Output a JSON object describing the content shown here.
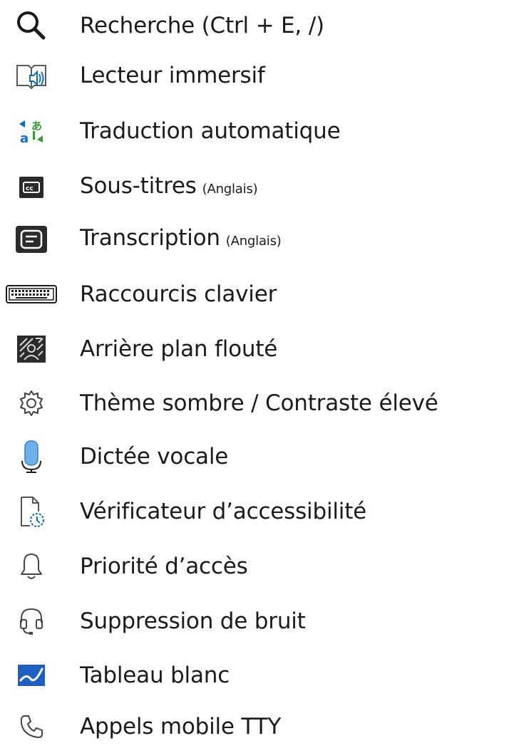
{
  "menu": {
    "items": [
      {
        "label": "Recherche (Ctrl + E, /)",
        "note": "",
        "icon": "search-icon"
      },
      {
        "label": "Lecteur immersif",
        "note": "",
        "icon": "immersive-reader-icon"
      },
      {
        "label": "Traduction automatique",
        "note": "",
        "icon": "translate-icon"
      },
      {
        "label": "Sous-titres",
        "note": "(Anglais)",
        "icon": "closed-captions-icon"
      },
      {
        "label": "Transcription",
        "note": "(Anglais)",
        "icon": "transcript-icon"
      },
      {
        "label": "Raccourcis clavier",
        "note": "",
        "icon": "keyboard-icon"
      },
      {
        "label": "Arrière plan flouté",
        "note": "",
        "icon": "blur-background-icon"
      },
      {
        "label": "Thème sombre / Contraste élevé",
        "note": "",
        "icon": "settings-gear-icon"
      },
      {
        "label": "Dictée vocale",
        "note": "",
        "icon": "microphone-icon"
      },
      {
        "label": "Vérificateur d’accessibilité",
        "note": "",
        "icon": "accessibility-checker-icon"
      },
      {
        "label": "Priorité d’accès",
        "note": "",
        "icon": "bell-icon"
      },
      {
        "label": "Suppression de bruit",
        "note": "",
        "icon": "headset-icon"
      },
      {
        "label": "Tableau blanc",
        "note": "",
        "icon": "whiteboard-icon"
      },
      {
        "label": "Appels mobile TTY",
        "note": "",
        "icon": "phone-icon"
      }
    ]
  },
  "colors": {
    "text": "#1b1b1b",
    "icon_dark": "#2b2b2b",
    "icon_blue": "#0f6cbd",
    "icon_green": "#3a9a3a",
    "mic_fill": "#6fb0e8",
    "whiteboard_blue": "#1f5fbf"
  }
}
